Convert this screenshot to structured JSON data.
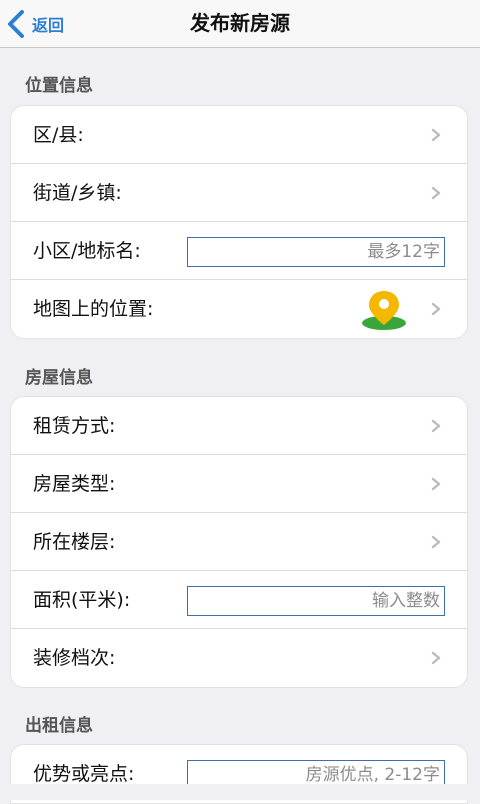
{
  "nav": {
    "back_label": "返回",
    "title": "发布新房源"
  },
  "sections": {
    "location": {
      "title": "位置信息",
      "district": "区/县:",
      "street": "街道/乡镇:",
      "community": "小区/地标名:",
      "community_placeholder": "最多12字",
      "map_position": "地图上的位置:"
    },
    "house": {
      "title": "房屋信息",
      "rent_type": "租赁方式:",
      "house_type": "房屋类型:",
      "floor": "所在楼层:",
      "area": "面积(平米):",
      "area_placeholder": "输入整数",
      "decoration": "装修档次:"
    },
    "rental": {
      "title": "出租信息",
      "highlights": "优势或亮点:",
      "highlights_placeholder": "房源优点, 2-12字"
    }
  },
  "colors": {
    "accent": "#2a7fd4",
    "pin_yellow": "#f5b800",
    "pin_ground": "#3aa63a"
  },
  "icons": {
    "back": "chevron-left-icon",
    "row_arrow": "chevron-right-icon",
    "map": "map-pin-icon"
  }
}
